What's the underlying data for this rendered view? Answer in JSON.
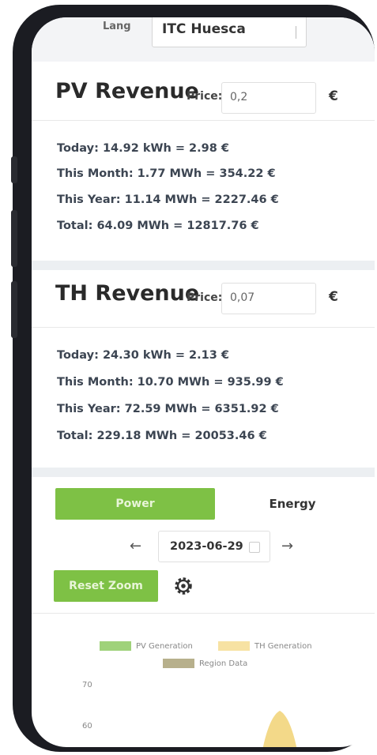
{
  "header": {
    "label_partial": "Lang",
    "select_value": "ITC Huesca"
  },
  "pv": {
    "title": "PV Revenue",
    "price_label": "Price:",
    "price_value": "0,2",
    "currency": "€",
    "lines": [
      "Today: 14.92 kWh = 2.98 €",
      "This Month: 1.77 MWh = 354.22 €",
      "This Year: 11.14 MWh = 2227.46 €",
      "Total: 64.09 MWh = 12817.76 €"
    ]
  },
  "th": {
    "title": "TH Revenue",
    "price_label": "Price:",
    "price_value": "0,07",
    "currency": "€",
    "lines": [
      "Today: 24.30 kWh = 2.13 €",
      "This Month: 10.70 MWh = 935.99 €",
      "This Year: 72.59 MWh = 6351.92 €",
      "Total: 229.18 MWh = 20053.46 €"
    ]
  },
  "controls": {
    "power_label": "Power",
    "energy_label": "Energy",
    "prev_arrow": "←",
    "next_arrow": "→",
    "date_value": "2023-06-29",
    "reset_zoom_label": "Reset Zoom",
    "settings_icon": "gear-icon"
  },
  "chart_data": {
    "type": "area",
    "legend": [
      {
        "name": "PV Generation",
        "color": "#9fd27a"
      },
      {
        "name": "TH Generation",
        "color": "#f7e2a3"
      },
      {
        "name": "Region Data",
        "color": "#b7b08c"
      }
    ],
    "y_ticks": [
      "70",
      "60"
    ],
    "colors": {
      "pv": "#9fd27a",
      "th": "#f7e2a3",
      "region": "#b7b08c"
    }
  },
  "colors": {
    "accent": "#7ec145",
    "frame": "#1b1c22"
  }
}
